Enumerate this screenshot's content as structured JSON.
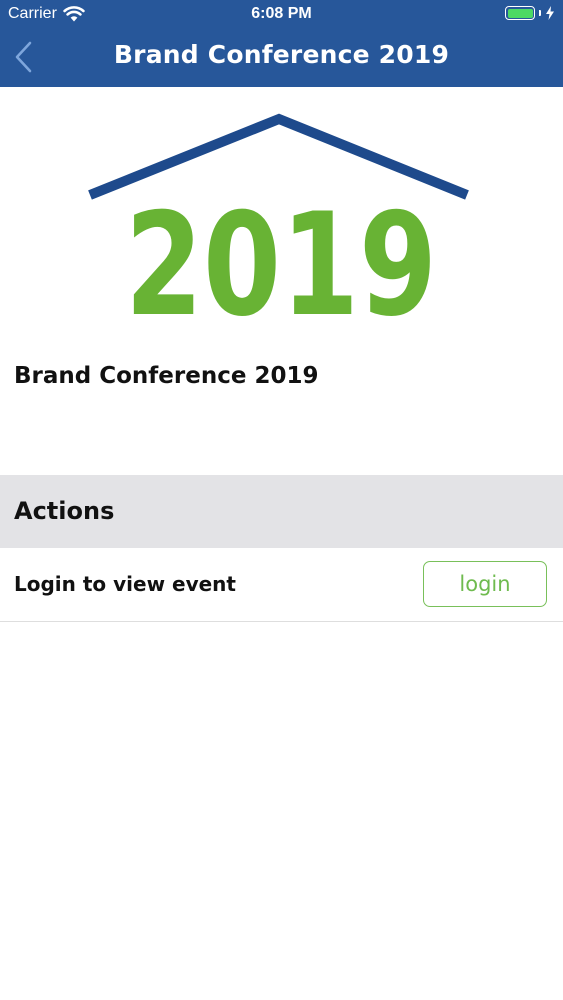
{
  "status_bar": {
    "carrier": "Carrier",
    "time": "6:08 PM",
    "battery_color": "#4cd964"
  },
  "nav": {
    "title": "Brand Conference 2019",
    "back_icon": "chevron-left-icon",
    "background_color": "#27579a"
  },
  "banner": {
    "year_text": "2019",
    "year_color": "#68b334",
    "roof_color": "#1e4a8c"
  },
  "event": {
    "title": "Brand Conference 2019"
  },
  "actions": {
    "header": "Actions",
    "rows": [
      {
        "label": "Login to view event",
        "button_label": "login",
        "button_color": "#79c05a"
      }
    ]
  }
}
